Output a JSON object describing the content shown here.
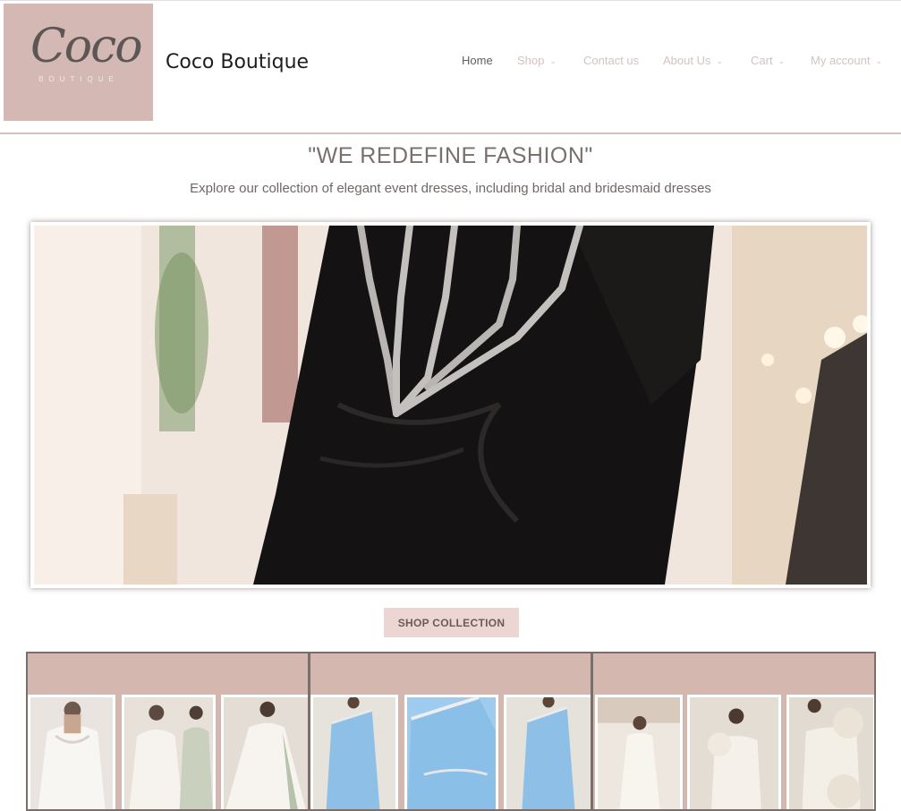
{
  "brand": {
    "logo_script": "Coco",
    "logo_sub": "BOUTIQUE",
    "site_title": "Coco Boutique",
    "logo_bg": "#d4b8b4"
  },
  "nav": {
    "items": [
      {
        "label": "Home",
        "dropdown": false,
        "active": true
      },
      {
        "label": "Shop",
        "dropdown": true,
        "active": false
      },
      {
        "label": "Contact us",
        "dropdown": false,
        "active": false
      },
      {
        "label": "About Us",
        "dropdown": true,
        "active": false
      },
      {
        "label": "Cart",
        "dropdown": true,
        "active": false
      },
      {
        "label": "My account",
        "dropdown": true,
        "active": false
      }
    ]
  },
  "hero": {
    "headline": "\"WE REDEFINE FASHION\"",
    "subline": "Explore our collection of elegant event dresses, including bridal and bridesmaid dresses",
    "image_desc": "black-gown-with-beaded-corset-detail"
  },
  "cta": {
    "shop_label": "SHOP COLLECTION",
    "color": "#ecd6d4"
  },
  "collections": [
    {
      "name": "white-bridal-gowns",
      "thumbs": [
        "white-lace-gown",
        "white-gown-with-sage-dress",
        "white-gown-with-overskirt"
      ]
    },
    {
      "name": "light-blue-satin-dresses",
      "thumbs": [
        "blue-one-shoulder-dress-front",
        "blue-one-shoulder-dress-closeup",
        "blue-one-shoulder-dress-alt"
      ]
    },
    {
      "name": "ivory-floral-gowns",
      "thumbs": [
        "ivory-gown-in-hall",
        "ivory-gown-ruffle-shoulder",
        "ivory-gown-rosette"
      ]
    }
  ],
  "colors": {
    "accent": "#d4c3c0",
    "panel_bg": "#d4b8b0"
  }
}
